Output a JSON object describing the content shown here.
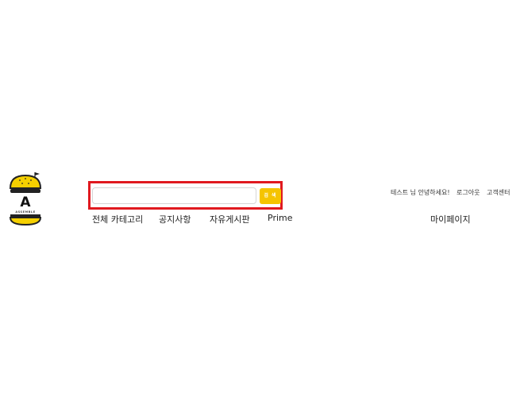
{
  "logo": {
    "letter": "A",
    "wordmark": "ASSEMBLE",
    "icon": "burger-logo-icon"
  },
  "search": {
    "value": "",
    "placeholder": "",
    "button_label": "검 색"
  },
  "nav": {
    "items": [
      {
        "label": "전체 카테고리"
      },
      {
        "label": "공지사항"
      },
      {
        "label": "자유게시판"
      },
      {
        "label": "Prime"
      }
    ],
    "mypage_label": "마이페이지"
  },
  "user_menu": {
    "greeting": "테스트 님 안녕하세요!",
    "logout_label": "로그아웃",
    "support_label": "고객센터"
  },
  "colors": {
    "accent": "#f5c400",
    "highlight": "#e0191f"
  }
}
